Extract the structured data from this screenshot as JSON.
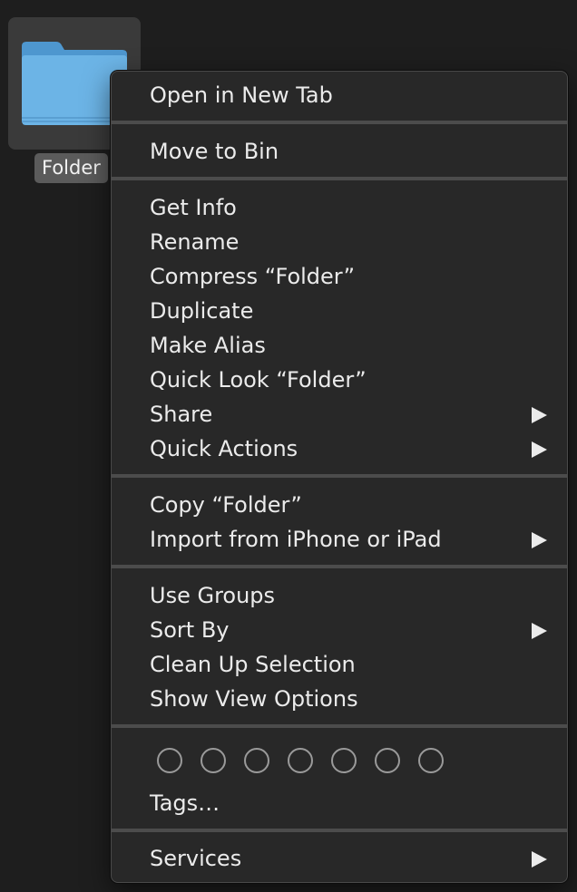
{
  "desktop": {
    "folder": {
      "label": "Folder",
      "icon": "folder-icon",
      "color": "#5aa8e0"
    }
  },
  "menu": {
    "items": [
      {
        "label": "Open in New Tab",
        "submenu": false
      },
      {
        "label": "Move to Bin",
        "submenu": false
      },
      {
        "label": "Get Info",
        "submenu": false
      },
      {
        "label": "Rename",
        "submenu": false
      },
      {
        "label": "Compress “Folder”",
        "submenu": false
      },
      {
        "label": "Duplicate",
        "submenu": false
      },
      {
        "label": "Make Alias",
        "submenu": false
      },
      {
        "label": "Quick Look “Folder”",
        "submenu": false
      },
      {
        "label": "Share",
        "submenu": true
      },
      {
        "label": "Quick Actions",
        "submenu": true
      },
      {
        "label": "Copy “Folder”",
        "submenu": false
      },
      {
        "label": "Import from iPhone or iPad",
        "submenu": true
      },
      {
        "label": "Use Groups",
        "submenu": false
      },
      {
        "label": "Sort By",
        "submenu": true
      },
      {
        "label": "Clean Up Selection",
        "submenu": false
      },
      {
        "label": "Show View Options",
        "submenu": false
      },
      {
        "label": "Tags…",
        "submenu": false
      },
      {
        "label": "Services",
        "submenu": true
      }
    ],
    "tag_colors": [
      "none",
      "none",
      "none",
      "none",
      "none",
      "none",
      "none"
    ]
  }
}
